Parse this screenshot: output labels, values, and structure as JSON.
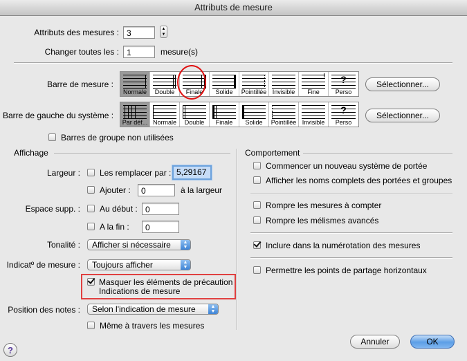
{
  "window": {
    "title": "Attributs de mesure"
  },
  "top": {
    "attributes_label": "Attributs des mesures :",
    "attributes_value": "3",
    "change_all_label": "Changer toutes les :",
    "change_all_value": "1",
    "change_all_unit": "mesure(s)"
  },
  "barline": {
    "label": "Barre de mesure :",
    "options": [
      "Normale",
      "Double",
      "Finale",
      "Solide",
      "Pointillée",
      "Invisible",
      "Fine",
      "Perso"
    ],
    "selected": "Normale",
    "select_button": "Sélectionner..."
  },
  "left_barline": {
    "label": "Barre de gauche du système :",
    "options": [
      "Par déf...",
      "Normale",
      "Double",
      "Finale",
      "Solide",
      "Pointillée",
      "Invisible",
      "Perso"
    ],
    "selected": "Par déf...",
    "select_button": "Sélectionner..."
  },
  "unused_group_barlines": "Barres de groupe non utilisées",
  "display": {
    "section_title": "Affichage",
    "width_label": "Largeur :",
    "replace_label": "Les remplacer par :",
    "replace_value": "5,29167",
    "add_label": "Ajouter :",
    "add_value": "0",
    "add_suffix": "à la largeur",
    "extra_space_label": "Espace supp. :",
    "at_start_label": "Au début :",
    "at_start_value": "0",
    "at_end_label": "A la fin :",
    "at_end_value": "0",
    "key_label": "Tonalité :",
    "key_value": "Afficher si nécessaire",
    "time_sig_label": "Indicatº de mesure :",
    "time_sig_value": "Toujours afficher",
    "hide_courtesy_line1": "Masquer les éléments de précaution",
    "hide_courtesy_line2": "Indications de mesure",
    "note_pos_label": "Position des notes :",
    "note_pos_value": "Selon l'indication de mesure",
    "across_measures": "Même à travers les mesures"
  },
  "behavior": {
    "section_title": "Comportement",
    "new_system": "Commencer un nouveau système de portée",
    "full_names": "Afficher les noms complets des portées et groupes",
    "break_multimeasure": "Rompre les mesures à compter",
    "break_melisma": "Rompre les mélismes avancés",
    "include_numbering": "Inclure dans la numérotation des mesures",
    "horizontal_split": "Permettre les points de partage horizontaux"
  },
  "footer": {
    "cancel": "Annuler",
    "ok": "OK",
    "help": "?"
  }
}
